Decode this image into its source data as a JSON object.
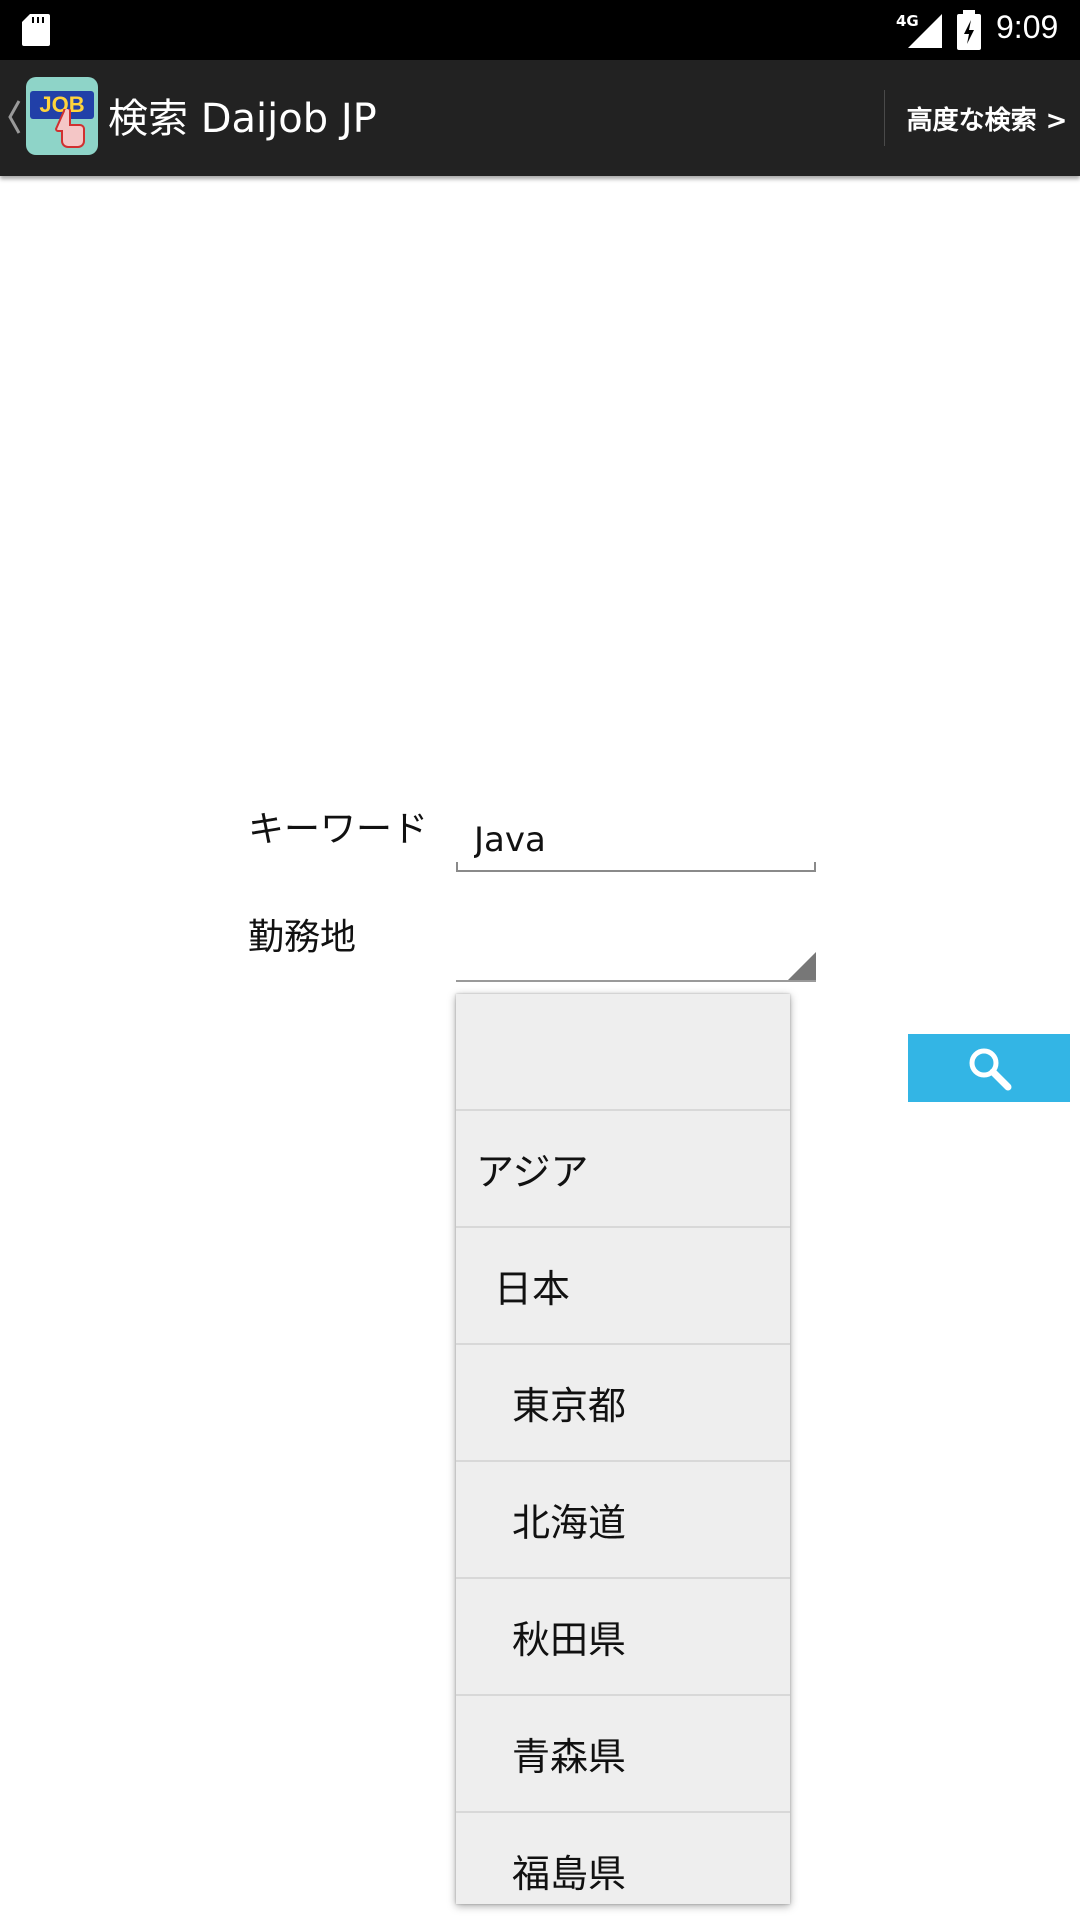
{
  "status_bar": {
    "time": "9:09",
    "network": "4G",
    "icons": [
      "sd-card-icon",
      "signal-icon",
      "battery-icon"
    ]
  },
  "action_bar": {
    "app_icon_text": "JOB",
    "title": "検索 Daijob JP",
    "advanced_search": "高度な検索 >"
  },
  "form": {
    "keyword_label": "キーワード",
    "keyword_value": "Java",
    "location_label": "勤務地",
    "search_button_icon": "search-icon"
  },
  "location_dropdown": {
    "options": [
      {
        "label": "",
        "level": 0
      },
      {
        "label": "アジア",
        "level": 0
      },
      {
        "label": "日本",
        "level": 1
      },
      {
        "label": "東京都",
        "level": 2
      },
      {
        "label": "北海道",
        "level": 2
      },
      {
        "label": "秋田県",
        "level": 2
      },
      {
        "label": "青森県",
        "level": 2
      },
      {
        "label": "福島県",
        "level": 2
      }
    ]
  },
  "colors": {
    "status_bar": "#000000",
    "action_bar": "#222222",
    "accent": "#33b5e5",
    "dropdown_bg": "#eeeeee"
  }
}
